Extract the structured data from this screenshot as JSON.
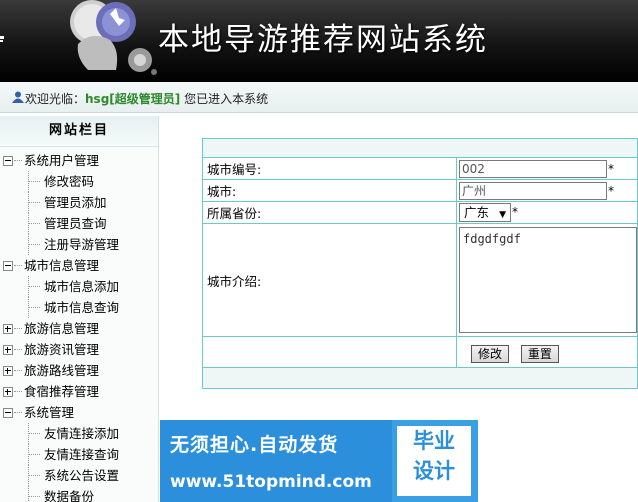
{
  "header": {
    "title": "本地导游推荐网站系统"
  },
  "welcome": {
    "prefix": "欢迎光临：",
    "username": "hsg[超级管理员]",
    "suffix": " 您已进入本系统"
  },
  "sidebar": {
    "title": "网站栏目",
    "items": [
      {
        "label": "系统用户管理",
        "type": "group",
        "expanded": true
      },
      {
        "label": "修改密码",
        "type": "leaf"
      },
      {
        "label": "管理员添加",
        "type": "leaf"
      },
      {
        "label": "管理员查询",
        "type": "leaf"
      },
      {
        "label": "注册导游管理",
        "type": "leaf"
      },
      {
        "label": "城市信息管理",
        "type": "group",
        "expanded": true
      },
      {
        "label": "城市信息添加",
        "type": "leaf"
      },
      {
        "label": "城市信息查询",
        "type": "leaf"
      },
      {
        "label": "旅游信息管理",
        "type": "group",
        "expanded": false
      },
      {
        "label": "旅游资讯管理",
        "type": "group",
        "expanded": false
      },
      {
        "label": "旅游路线管理",
        "type": "group",
        "expanded": false
      },
      {
        "label": "食宿推荐管理",
        "type": "group",
        "expanded": false
      },
      {
        "label": "系统管理",
        "type": "group",
        "expanded": true
      },
      {
        "label": "友情连接添加",
        "type": "leaf"
      },
      {
        "label": "友情连接查询",
        "type": "leaf"
      },
      {
        "label": "系统公告设置",
        "type": "leaf"
      },
      {
        "label": "数据备份",
        "type": "leaf"
      }
    ]
  },
  "form": {
    "city_code_label": "城市编号:",
    "city_code_value": "002",
    "city_label": "城市:",
    "city_value": "广州",
    "province_label": "所属省份:",
    "province_selected": "广东",
    "intro_label": "城市介绍:",
    "intro_value": "fdgdfgdf",
    "required_mark": "*",
    "submit_label": "修改",
    "reset_label": "重置"
  },
  "ad": {
    "line1": "无须担心.自动发货",
    "line2": "www.51topmind.com",
    "badge_line1": "毕业",
    "badge_line2": "设计"
  },
  "colors": {
    "header_bg": "#1a1a1a",
    "table_border": "#66cccc",
    "username": "#2e8a2e",
    "ad_blue": "#2b8fdc"
  }
}
